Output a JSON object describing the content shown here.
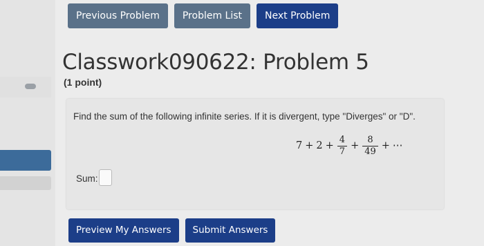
{
  "nav": {
    "previous_label": "Previous Problem",
    "list_label": "Problem List",
    "next_label": "Next Problem"
  },
  "header": {
    "title": "Classwork090622: Problem 5",
    "points": "(1 point)"
  },
  "problem": {
    "question": "Find the sum of the following infinite series. If it is divergent, type \"Diverges\" or \"D\".",
    "series": {
      "term1": "7",
      "plus1": "+",
      "term2": "2",
      "plus2": "+",
      "frac1_num": "4",
      "frac1_den": "7",
      "plus3": "+",
      "frac2_num": "8",
      "frac2_den": "49",
      "plus4": "+",
      "ellipsis": "⋯"
    },
    "answer_label": "Sum:",
    "answer_value": ""
  },
  "actions": {
    "preview_label": "Preview My Answers",
    "submit_label": "Submit Answers"
  },
  "colors": {
    "nav_button": "#5a7189",
    "primary_button": "#1c3e88"
  }
}
